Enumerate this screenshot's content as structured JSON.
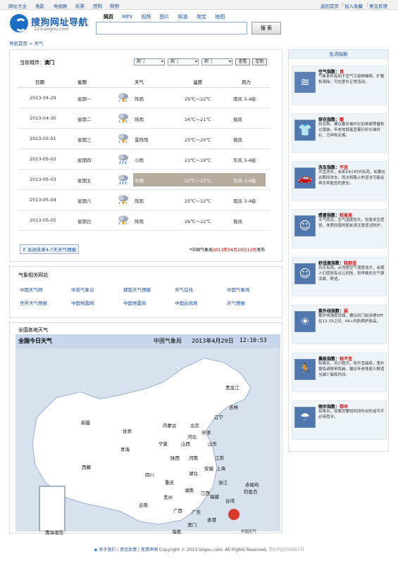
{
  "topbar": {
    "left": [
      "网址大全",
      "电影",
      "电视剧",
      "彩票",
      "团购",
      "购物"
    ],
    "right": [
      "返回首页",
      "加入收藏",
      "意见反馈"
    ]
  },
  "header": {
    "logo_text": "搜狗网址导航",
    "logo_sub": "123.sogou.com",
    "nav": [
      "网页",
      "MP3",
      "视频",
      "图片",
      "知道",
      "淘宝",
      "地图"
    ],
    "search_button": "搜 索"
  },
  "breadcrumb": "导航首页 > 天气",
  "weather": {
    "current_city_label": "当前城市：",
    "current_city": "澳门",
    "selects": [
      "澳门",
      "澳门",
      "澳门"
    ],
    "query_button": "查看",
    "custom_button": "定制",
    "columns": [
      "日期",
      "星期",
      "天气",
      "温度",
      "风力"
    ],
    "rows": [
      {
        "date": "2013-04-29",
        "week": "星期一",
        "weather": "阵雨",
        "temp": "26℃～22℃",
        "wind": "南风 3-4级",
        "icon": "thunder-rain"
      },
      {
        "date": "2013-04-30",
        "week": "星期二",
        "weather": "阵雨",
        "temp": "26℃～21℃",
        "wind": "微风",
        "icon": "thunder-rain"
      },
      {
        "date": "2013-05-01",
        "week": "星期三",
        "weather": "雷阵雨",
        "temp": "25℃～20℃",
        "wind": "微风",
        "icon": "thunder-rain"
      },
      {
        "date": "2013-05-02",
        "week": "星期四",
        "weather": "小雨",
        "temp": "23℃～19℃",
        "wind": "东风 3-4级",
        "icon": "rain"
      },
      {
        "date": "2013-05-03",
        "week": "星期五",
        "weather": "中雨",
        "temp": "22℃～21℃",
        "wind": "东风 3-4级",
        "icon": "rain"
      },
      {
        "date": "2013-05-04",
        "week": "星期六",
        "weather": "阵雨",
        "temp": "25℃～22℃",
        "wind": "南风 3-4级",
        "icon": "thunder-rain"
      },
      {
        "date": "2013-05-05",
        "week": "星期日",
        "weather": "阵雨",
        "temp": "26℃～22℃",
        "wind": "微风",
        "icon": "thunder-rain"
      }
    ],
    "close_link": "关闭未来4-7天天气预报",
    "source_prefix": "*中国气象局",
    "source_time": "2013年04月29日11时",
    "source_suffix": "发布"
  },
  "links": {
    "title": "气象相关网站",
    "items": [
      "中国天气网",
      "中央气象台",
      "搜狐天气预报",
      "天气在线",
      "中国气象局",
      "世界天气预报",
      "中国地震网",
      "中国地震局",
      "中国台风网",
      "天气预报"
    ]
  },
  "map": {
    "title": "全国各地天气",
    "head_left": "全国今日天气",
    "head_org": "中国气象局",
    "head_date": "2013年4月29日",
    "head_time": "12:10:53",
    "provinces": [
      "黑龙江",
      "吉林",
      "辽宁",
      "内蒙古",
      "北京",
      "天津",
      "河北",
      "新疆",
      "甘肃",
      "宁夏",
      "山西",
      "山东",
      "青海",
      "陕西",
      "河南",
      "江苏",
      "西藏",
      "四川",
      "湖北",
      "安徽",
      "上海",
      "重庆",
      "浙江",
      "贵州",
      "湖南",
      "江西",
      "福建",
      "台湾",
      "云南",
      "广西",
      "广东",
      "香港",
      "澳门",
      "海南",
      "钓鱼岛",
      "赤尾屿",
      "南海诸岛",
      "中国天气"
    ]
  },
  "life": {
    "title": "生活指数",
    "items": [
      {
        "name": "空气指数：",
        "level": "良",
        "desc": "气象条件有利于空气污染物稀释、扩散和清除，可在室外正常活动。",
        "icon": "air-icon",
        "color": "#5a7fb5"
      },
      {
        "name": "穿衣指数：",
        "level": "暖",
        "desc": "较凉爽，建议着长袖衬衫加单裤等春秋过渡装。年老体弱者宜着针织长袖衬衫、马甲和长裤。",
        "icon": "shirt-icon",
        "color": "#4f77ad"
      },
      {
        "name": "洗车指数：",
        "level": "不宜",
        "desc": "不宜洗车，未来24小时内有雨，如果在此期间洗车，雨水和路上的泥水可能会再次弄脏您的爱车。",
        "icon": "car-icon",
        "color": "#4f77ad"
      },
      {
        "name": "感冒指数：",
        "level": "较易发",
        "desc": "天气转凉，空气湿度较大，较易发生感冒，体质较弱的朋友请注意适当防护。",
        "icon": "mask-icon",
        "color": "#4f77ad"
      },
      {
        "name": "舒适度指数：",
        "level": "较舒适",
        "desc": "白天有雨，从而使空气湿度加大，会使人们感觉有点儿闷热，但早晚的天气很凉爽、舒适。",
        "icon": "smile-icon",
        "color": "#4f77ad"
      },
      {
        "name": "紫外线指数：",
        "level": "弱",
        "desc": "紫外线强度较弱，建议出门前涂擦SPF在12-15之间、PA+的防晒护肤品。",
        "icon": "sun-icon",
        "color": "#4f77ad"
      },
      {
        "name": "晨练指数：",
        "level": "较不宜",
        "desc": "有降水，风力稍大，较不宜晨练，室外锻炼请携带雨具。建议年老体弱人群适当减少晨练时间。",
        "icon": "runner-icon",
        "color": "#4f77ad"
      },
      {
        "name": "雨伞指数：",
        "level": "带伞",
        "desc": "有降水，如果您要短时间外出的话可不必带雨伞。",
        "icon": "umbrella-icon",
        "color": "#4f77ad"
      }
    ]
  },
  "footer": {
    "links": [
      "关于我们",
      "意见反馈",
      "免责声明"
    ],
    "copyright": "Copyright © 2013 Sogou.com. All Rights Reserved.",
    "icp": "京ICP证050897号"
  }
}
